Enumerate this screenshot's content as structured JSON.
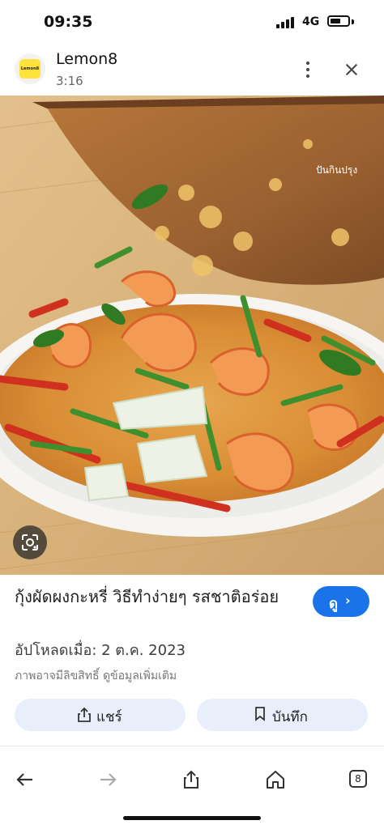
{
  "status": {
    "time": "09:35",
    "network": "4G"
  },
  "app": {
    "name": "Lemon8",
    "subtitle": "3:16",
    "logo_text": "Lemon8"
  },
  "image": {
    "watermark": "ปันกินปรุง"
  },
  "result": {
    "title": "กุ้งผัดผงกะหรี่ วิธีทำง่ายๆ รสชาติอร่อย",
    "view_label": "ดู",
    "upload_date": "อัปโหลดเมื่อ: 2 ต.ค. 2023",
    "copyright": "ภาพอาจมีลิขสิทธิ์ ดูข้อมูลเพิ่มเติม"
  },
  "actions": {
    "share_label": "แชร์",
    "save_label": "บันทึก"
  },
  "nav": {
    "tabs_count": "8"
  },
  "colors": {
    "accent": "#1a73e8",
    "chip_bg": "#e8effb"
  }
}
